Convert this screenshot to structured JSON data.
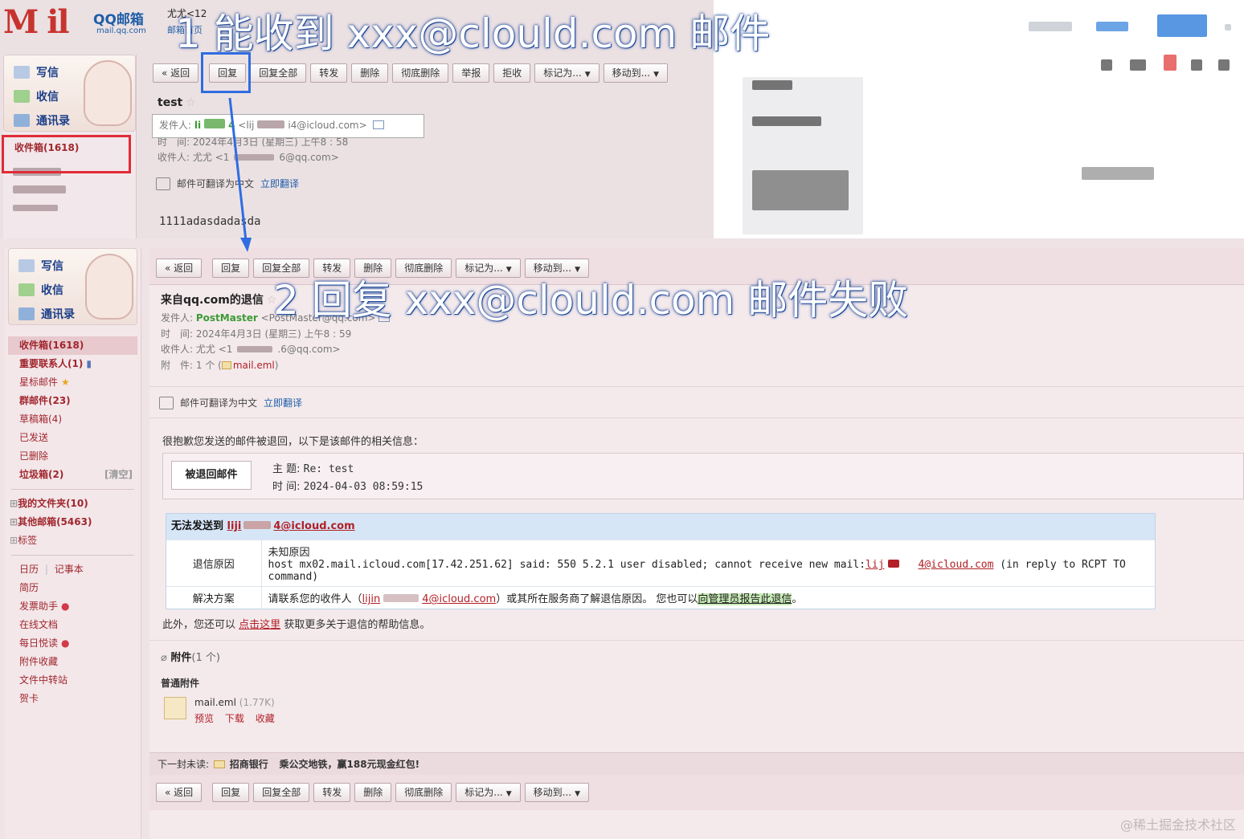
{
  "annotations": {
    "step1": "1 能收到 xxx@clould.com 邮件",
    "step2": "2 回复 xxx@clould.com 邮件失败"
  },
  "brand": {
    "name": "QQ邮箱",
    "url": "mail.qq.com",
    "logo_text": "M  il"
  },
  "top_panel": {
    "user_line": "尤尤<12",
    "user_sub": "邮箱首页",
    "nav": {
      "compose": "写信",
      "receive": "收信",
      "contacts": "通讯录",
      "inbox": "收件箱(1618)"
    },
    "toolbar": [
      "« 返回",
      "回复",
      "回复全部",
      "转发",
      "删除",
      "彻底删除",
      "举报",
      "拒收",
      "标记为...",
      "移动到..."
    ],
    "subject": "test",
    "from_label": "发件人:",
    "from_name": "li",
    "from_suffix": "4",
    "from_addr": "<lij",
    "from_addr_tail": "i4@icloud.com>",
    "time_label": "时　间:",
    "time_value": "2024年4月3日 (星期三) 上午8 : 58",
    "to_label": "收件人:",
    "to_name": "尤尤 <1",
    "to_tail": "6@qq.com>",
    "translate_text": "邮件可翻译为中文",
    "translate_link": "立即翻译",
    "body": "1111adasdadasda"
  },
  "bottom_panel": {
    "nav": {
      "compose": "写信",
      "receive": "收信",
      "contacts": "通讯录",
      "folders": [
        {
          "label": "收件箱(1618)"
        },
        {
          "label": "重要联系人(1)"
        },
        {
          "label": "星标邮件"
        },
        {
          "label": "群邮件(23)"
        },
        {
          "label": "草稿箱(4)"
        },
        {
          "label": "已发送"
        },
        {
          "label": "已删除"
        },
        {
          "label": "垃圾箱(2)",
          "extra": "[清空]"
        }
      ],
      "groups": [
        "我的文件夹(10)",
        "其他邮箱(5463)",
        "标签"
      ],
      "tools": [
        "日历",
        "记事本",
        "简历",
        "发票助手",
        "在线文档",
        "每日悦读",
        "附件收藏",
        "文件中转站",
        "贺卡"
      ],
      "tools_sep": "|"
    },
    "toolbar": [
      "« 返回",
      "回复",
      "回复全部",
      "转发",
      "删除",
      "彻底删除",
      "标记为...",
      "移动到..."
    ],
    "subject": "来自qq.com的退信",
    "from_label": "发件人:",
    "from_name": "PostMaster",
    "from_addr": "<PostMaster@qq.com>",
    "time_label": "时　间:",
    "time_value": "2024年4月3日 (星期三) 上午8 : 59",
    "to_label": "收件人:",
    "to_value": "尤尤 <1",
    "to_tail": ".6@qq.com>",
    "attach_label": "附　件:",
    "attach_value": "1 个 (",
    "attach_name": "mail.eml",
    "attach_close": ")",
    "translate_text": "邮件可翻译为中文",
    "translate_link": "立即翻译",
    "bounce_intro": "很抱歉您发送的邮件被退回，以下是该邮件的相关信息：",
    "bounced_btn": "被退回邮件",
    "subject_label": "主 题:",
    "subject_value": "Re: test",
    "time2_label": "时 间:",
    "time2_value": "2024-04-03 08:59:15",
    "fail_prefix": "无法发送到",
    "fail_addr_a": "liji",
    "fail_addr_b": "4@icloud.com",
    "reason_label": "退信原因",
    "reason_title": "未知原因",
    "reason_detail": "host mx02.mail.icloud.com[17.42.251.62] said: 550 5.2.1 user disabled; cannot receive new mail:",
    "reason_addr_a": "lij",
    "reason_addr_b": "4@icloud.com",
    "reason_tail": "(in reply to RCPT TO command)",
    "solution_label": "解决方案",
    "solution_pre": "请联系您的收件人（",
    "solution_addr_a": "lijin",
    "solution_addr_b": "4@icloud.com",
    "solution_mid": "）或其所在服务商了解退信原因。 您也可以",
    "solution_link": "向管理员报告此退信",
    "solution_end": "。",
    "extra_pre": "此外，您还可以",
    "extra_link": "点击这里",
    "extra_post": "获取更多关于退信的帮助信息。",
    "attachments_title": "附件",
    "attachments_count": "(1 个)",
    "attachments_sub": "普通附件",
    "file_name": "mail.eml",
    "file_size": "(1.77K)",
    "file_actions": [
      "预览",
      "下载",
      "收藏"
    ],
    "next_label": "下一封未读:",
    "next_sender": "招商银行",
    "next_subject": "乘公交地铁，赢188元现金红包!",
    "bottom_toolbar": [
      "« 返回",
      "回复",
      "回复全部",
      "转发",
      "删除",
      "彻底删除",
      "标记为...",
      "移动到..."
    ]
  },
  "watermark": "@稀土掘金技术社区",
  "colors": {
    "accent_red": "#b21f26",
    "link_blue": "#1f5ea8",
    "highlight_blue_box": "#2f6de0",
    "highlight_red_box": "#e02b38"
  }
}
